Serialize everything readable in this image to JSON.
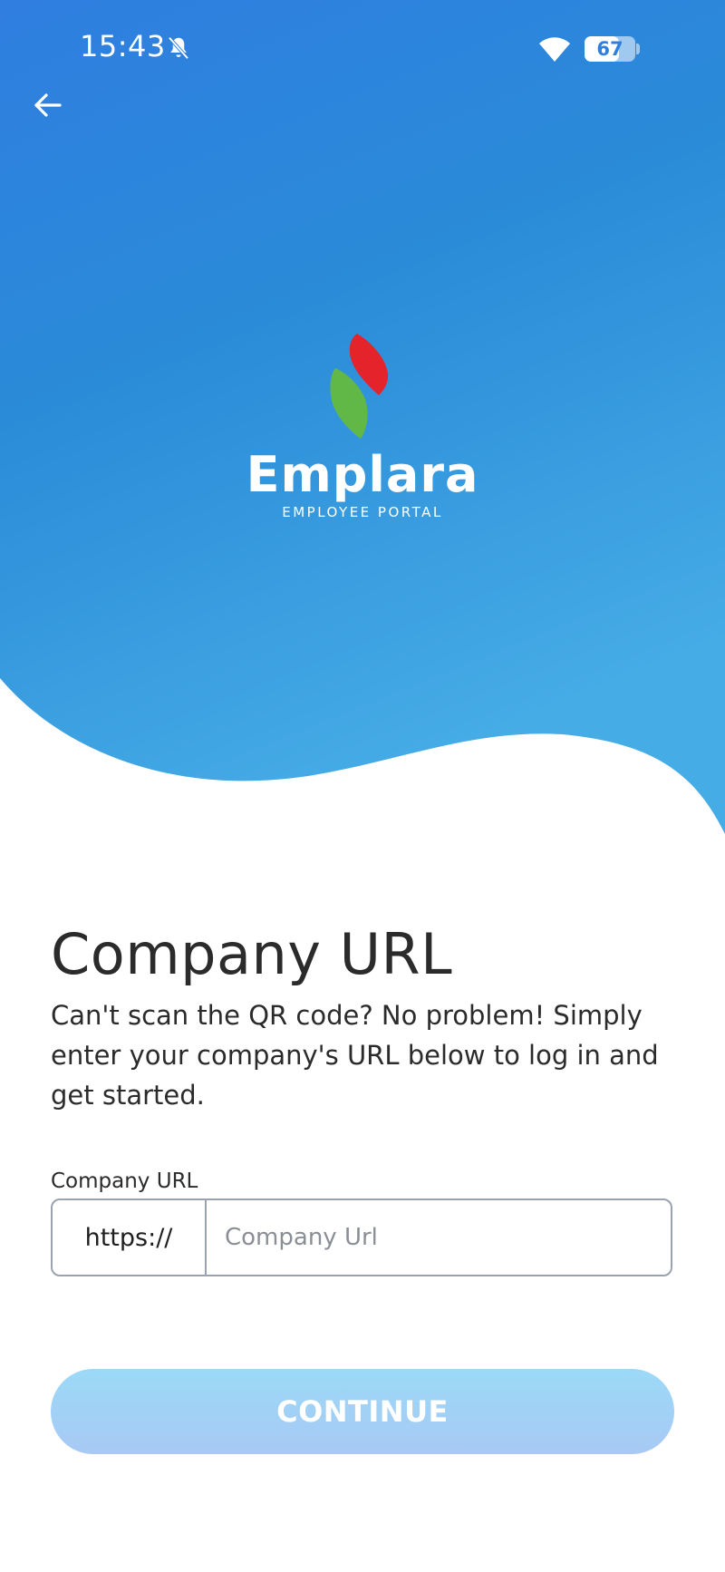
{
  "status_bar": {
    "time": "15:43",
    "battery_level": "67",
    "battery_fraction": 0.67
  },
  "header": {
    "back_icon": "arrow-left-icon"
  },
  "brand": {
    "name": "Emplara",
    "tagline": "EMPLOYEE PORTAL",
    "colors": {
      "leaf_red": "#e5232b",
      "leaf_green": "#62b846"
    }
  },
  "page": {
    "title": "Company URL",
    "description": "Can't scan the QR code? No problem! Simply enter your company's URL below to log in and get started."
  },
  "form": {
    "field_label": "Company URL",
    "prefix": "https://",
    "input_value": "",
    "input_placeholder": "Company Url"
  },
  "actions": {
    "continue_label": "CONTINUE"
  },
  "theme": {
    "primary_blue": "#2f7ee0",
    "light_blue": "#44aae8",
    "button_color": "#9fd2f6"
  }
}
